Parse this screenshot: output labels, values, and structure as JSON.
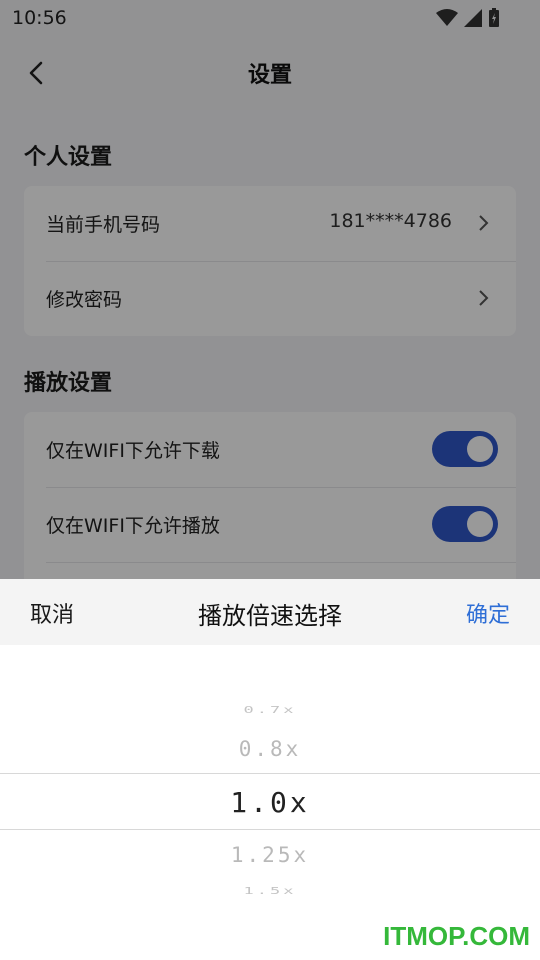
{
  "status_bar": {
    "time": "10:56"
  },
  "header": {
    "title": "设置"
  },
  "sections": {
    "personal": {
      "title": "个人设置",
      "phone_label": "当前手机号码",
      "phone_value": "181****4786",
      "password_label": "修改密码"
    },
    "playback": {
      "title": "播放设置",
      "download_wifi_label": "仅在WIFI下允许下载",
      "download_wifi_on": true,
      "play_wifi_label": "仅在WIFI下允许播放",
      "play_wifi_on": true
    }
  },
  "sheet": {
    "cancel": "取消",
    "title": "播放倍速选择",
    "confirm": "确定",
    "options": [
      "0.7x",
      "0.8x",
      "1.0x",
      "1.25x",
      "1.5x"
    ],
    "selected": "1.0x"
  },
  "watermark": "ITMOP.COM",
  "colors": {
    "accent": "#2f57c9",
    "confirm": "#2e6ed6",
    "watermark": "#35b83a"
  }
}
